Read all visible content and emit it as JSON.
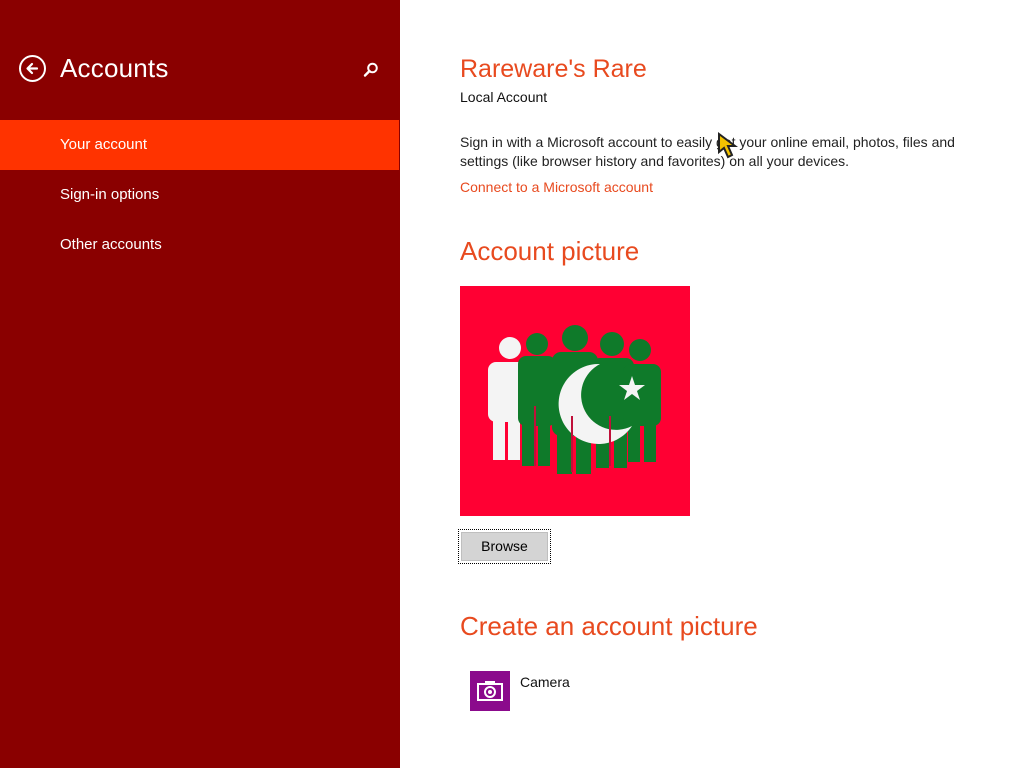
{
  "sidebar": {
    "title": "Accounts",
    "back_icon": "back-arrow-icon",
    "search_icon": "search-icon",
    "items": [
      {
        "label": "Your account",
        "selected": true
      },
      {
        "label": "Sign-in options",
        "selected": false
      },
      {
        "label": "Other accounts",
        "selected": false
      }
    ]
  },
  "account": {
    "name": "Rareware's Rare",
    "type": "Local Account",
    "signin_description": "Sign in with a Microsoft account to easily get your online email, photos, files and settings (like browser history and favorites) on all your devices.",
    "connect_link": "Connect to a Microsoft account"
  },
  "picture": {
    "heading": "Account picture",
    "browse_label": "Browse"
  },
  "create": {
    "heading": "Create an account picture",
    "camera_label": "Camera",
    "camera_icon": "camera-icon"
  },
  "colors": {
    "sidebar_bg": "#8a0000",
    "selected_bg": "#ff3300",
    "accent": "#e84a1f",
    "picture_bg": "#ff0033",
    "camera_tile": "#8b0a8c"
  }
}
